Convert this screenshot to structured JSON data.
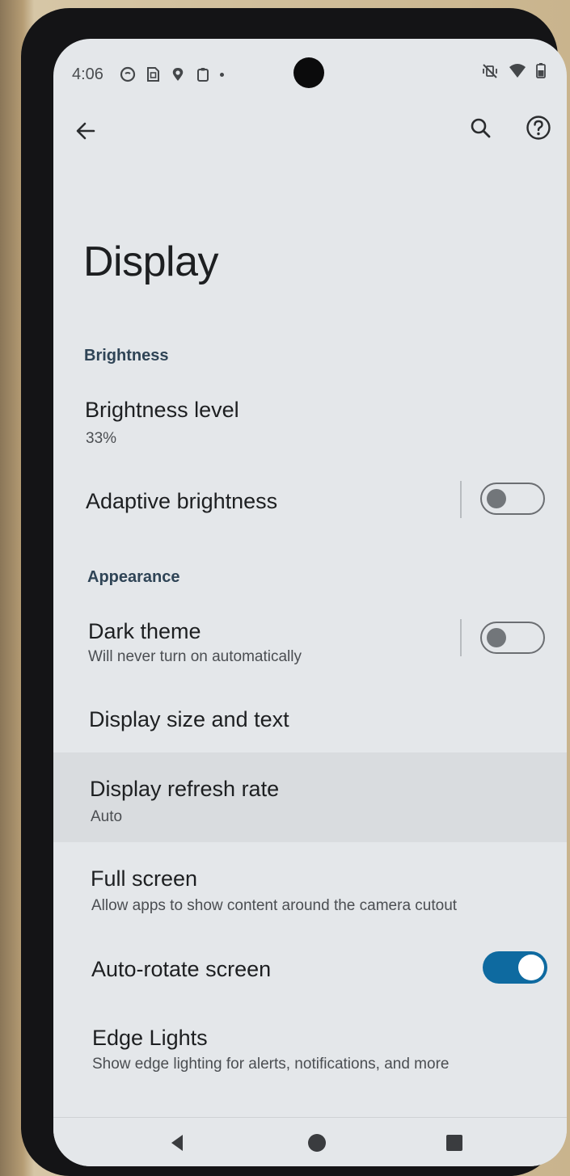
{
  "status_bar": {
    "time": "4:06",
    "icons": [
      "tiktok-icon",
      "sim-icon",
      "location-pin-icon",
      "clipboard-icon",
      "dot-icon"
    ],
    "right_icons": [
      "mute-vibrate-icon",
      "wifi-icon",
      "battery-icon"
    ]
  },
  "toolbar": {
    "back_icon": "arrow-left-icon",
    "search_icon": "search-icon",
    "help_icon": "help-circle-icon"
  },
  "page": {
    "title": "Display"
  },
  "sections": {
    "brightness": {
      "header": "Brightness",
      "brightness_level": {
        "title": "Brightness level",
        "value": "33%"
      },
      "adaptive_brightness": {
        "title": "Adaptive brightness",
        "enabled": false
      }
    },
    "appearance": {
      "header": "Appearance",
      "dark_theme": {
        "title": "Dark theme",
        "subtitle": "Will never turn on automatically",
        "enabled": false
      },
      "display_size": {
        "title": "Display size and text"
      },
      "refresh_rate": {
        "title": "Display refresh rate",
        "value": "Auto"
      },
      "full_screen": {
        "title": "Full screen",
        "subtitle": "Allow apps to show content around the camera cutout"
      },
      "auto_rotate": {
        "title": "Auto-rotate screen",
        "enabled": true
      },
      "edge_lights": {
        "title": "Edge Lights",
        "subtitle": "Show edge lighting for alerts, notifications, and more"
      }
    }
  },
  "nav_bar": {
    "back": "triangle-back-icon",
    "home": "circle-home-icon",
    "recents": "square-recents-icon"
  },
  "colors": {
    "accent": "#0e6aa0",
    "section_header": "#2f4456",
    "background": "#e4e7ea"
  }
}
